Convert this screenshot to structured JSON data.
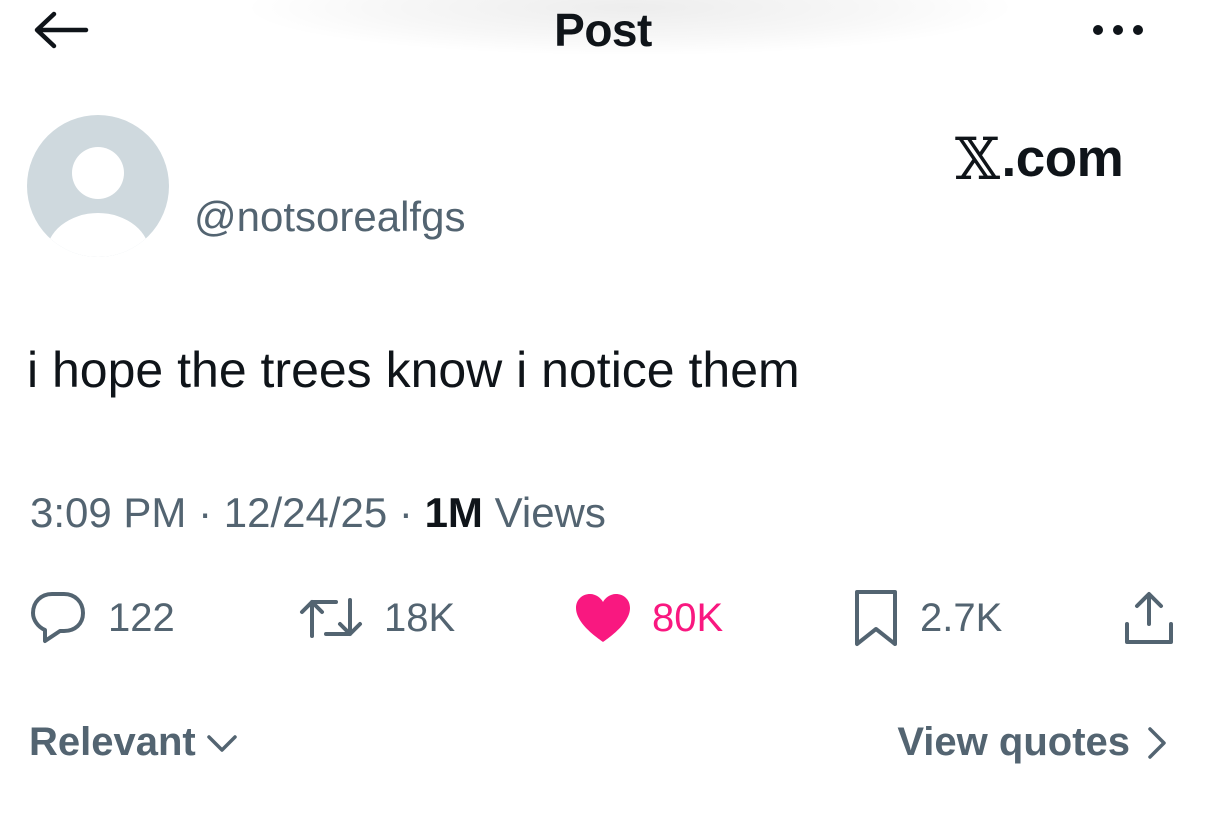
{
  "header": {
    "title": "Post",
    "back_icon": "arrow-left-icon",
    "more_icon": "ellipsis-horizontal-icon"
  },
  "author": {
    "handle": "@notsorealfgs",
    "avatar_icon": "default-avatar-icon"
  },
  "watermark": {
    "x_glyph": "𝕏",
    "domain": ".com"
  },
  "post": {
    "text": "i hope the trees know i notice them"
  },
  "meta": {
    "time": "3:09 PM",
    "sep1": " · ",
    "date": "12/24/25",
    "sep2": " · ",
    "views_count": "1M",
    "views_label": " Views"
  },
  "actions": {
    "replies": {
      "count": "122",
      "icon": "reply-icon"
    },
    "reposts": {
      "count": "18K",
      "icon": "repost-icon"
    },
    "likes": {
      "count": "80K",
      "icon": "heart-icon",
      "liked": true
    },
    "bookmarks": {
      "count": "2.7K",
      "icon": "bookmark-icon"
    },
    "share": {
      "icon": "share-icon"
    }
  },
  "footer": {
    "sort_label": "Relevant",
    "quotes_label": "View quotes"
  },
  "colors": {
    "text_primary": "#0f1419",
    "text_secondary": "#536471",
    "like_pink": "#f91880",
    "avatar_bg": "#cfd9de"
  }
}
